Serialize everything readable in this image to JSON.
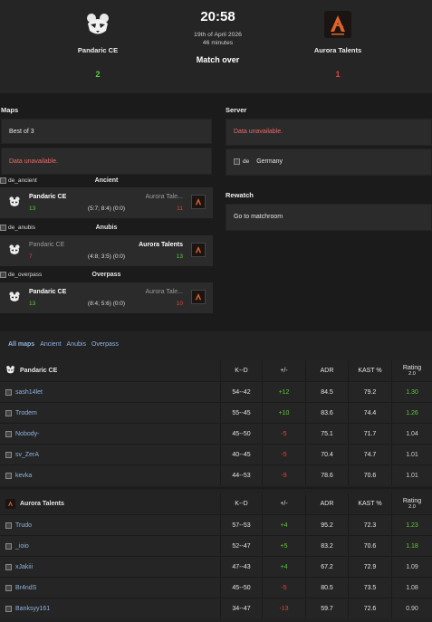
{
  "match": {
    "time": "20:58",
    "date": "19th of April 2026",
    "duration": "46 minutes",
    "status": "Match over"
  },
  "team1": {
    "name": "Pandaric CE",
    "score": "2",
    "logo_icon": "panda-logo-icon"
  },
  "team2": {
    "name": "Aurora Talents",
    "score": "1",
    "logo_icon": "aurora-logo-icon"
  },
  "maps_section": {
    "label": "Maps",
    "format": "Best of 3",
    "veto_status": "Data unavailable."
  },
  "server_section": {
    "label": "Server",
    "status": "Data unavailable.",
    "location_alt": "de",
    "location": "Germany"
  },
  "rewatch_section": {
    "label": "Rewatch",
    "link": "Go to matchroom"
  },
  "maps": [
    {
      "img_alt": "de_ancient",
      "name": "Ancient",
      "team1": "Pandaric CE",
      "team1_score": "13",
      "team2": "Aurora Tale...",
      "team2_score": "11",
      "halves": "(5:7; 8:4) (0:0)"
    },
    {
      "img_alt": "de_anubis",
      "name": "Anubis",
      "team1": "Pandaric CE",
      "team1_score": "7",
      "team2": "Aurora Talents",
      "team2_score": "13",
      "halves": "(4:8; 3:5) (0:0)"
    },
    {
      "img_alt": "de_overpass",
      "name": "Overpass",
      "team1": "Pandaric CE",
      "team1_score": "13",
      "team2": "Aurora Tale...",
      "team2_score": "10",
      "halves": "(8:4; 5:6) (0:0)"
    }
  ],
  "tabs": [
    "All maps",
    "Ancient",
    "Anubis",
    "Overpass"
  ],
  "table_headers": {
    "kd": "K--D",
    "diff": "+/-",
    "adr": "ADR",
    "kast": "KAST %",
    "rating": "Rating",
    "rating_ver": "2.0"
  },
  "team1_players": [
    {
      "name": "sash14let",
      "kd": "54--42",
      "diff": "+12",
      "adr": "84.5",
      "kast": "79.2",
      "rating": "1.30"
    },
    {
      "name": "Trodem",
      "kd": "55--45",
      "diff": "+10",
      "adr": "83.6",
      "kast": "74.4",
      "rating": "1.26"
    },
    {
      "name": "Nobody-",
      "kd": "45--50",
      "diff": "-5",
      "adr": "75.1",
      "kast": "71.7",
      "rating": "1.04"
    },
    {
      "name": "sv_ZerA",
      "kd": "40--45",
      "diff": "-5",
      "adr": "70.4",
      "kast": "74.7",
      "rating": "1.01"
    },
    {
      "name": "kevka",
      "kd": "44--53",
      "diff": "-9",
      "adr": "78.6",
      "kast": "70.6",
      "rating": "1.01"
    }
  ],
  "team2_players": [
    {
      "name": "Trudo",
      "kd": "57--53",
      "diff": "+4",
      "adr": "95.2",
      "kast": "72.3",
      "rating": "1.23"
    },
    {
      "name": "_ioio",
      "kd": "52--47",
      "diff": "+5",
      "adr": "83.2",
      "kast": "70.6",
      "rating": "1.18"
    },
    {
      "name": "xJakiii",
      "kd": "47--43",
      "diff": "+4",
      "adr": "67.2",
      "kast": "72.9",
      "rating": "1.09"
    },
    {
      "name": "Br4ndS",
      "kd": "45--50",
      "diff": "-5",
      "adr": "80.5",
      "kast": "73.5",
      "rating": "1.08"
    },
    {
      "name": "Banksyy161",
      "kd": "34--47",
      "diff": "-13",
      "adr": "59.7",
      "kast": "72.6",
      "rating": "0.90"
    }
  ],
  "colors": {
    "win": "#5ccc38",
    "loss": "#e0443a",
    "link": "#8fb3df",
    "error": "#e86a6a"
  }
}
